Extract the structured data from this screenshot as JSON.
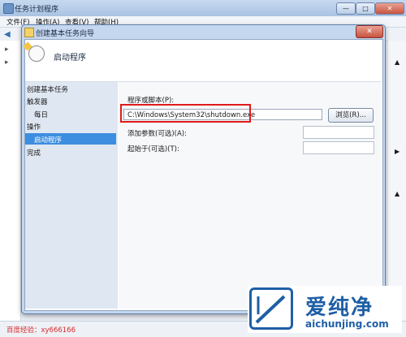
{
  "background_window": {
    "title": "任务计划程序",
    "menu": [
      "文件(F)",
      "操作(A)",
      "查看(V)",
      "帮助(H)"
    ]
  },
  "dialog": {
    "title": "创建基本任务向导",
    "header_title": "启动程序",
    "close_label": "✕",
    "nav": {
      "create": "创建基本任务",
      "trigger": "触发器",
      "daily": "每日",
      "action": "操作",
      "start_program": "启动程序",
      "finish": "完成"
    },
    "program_label": "程序或脚本(P):",
    "program_value": "C:\\Windows\\System32\\shutdown.exe",
    "browse_label": "浏览(R)...",
    "args_label": "添加参数(可选)(A):",
    "start_in_label": "起始于(可选)(T):"
  },
  "status_text": "百度经验：xy666166",
  "watermark": {
    "title": "爱纯净",
    "url": "aichunjing.com"
  },
  "colors": {
    "highlight": "#e01b1b",
    "nav_selected": "#3d8ee0",
    "brand": "#1e5fa6"
  }
}
